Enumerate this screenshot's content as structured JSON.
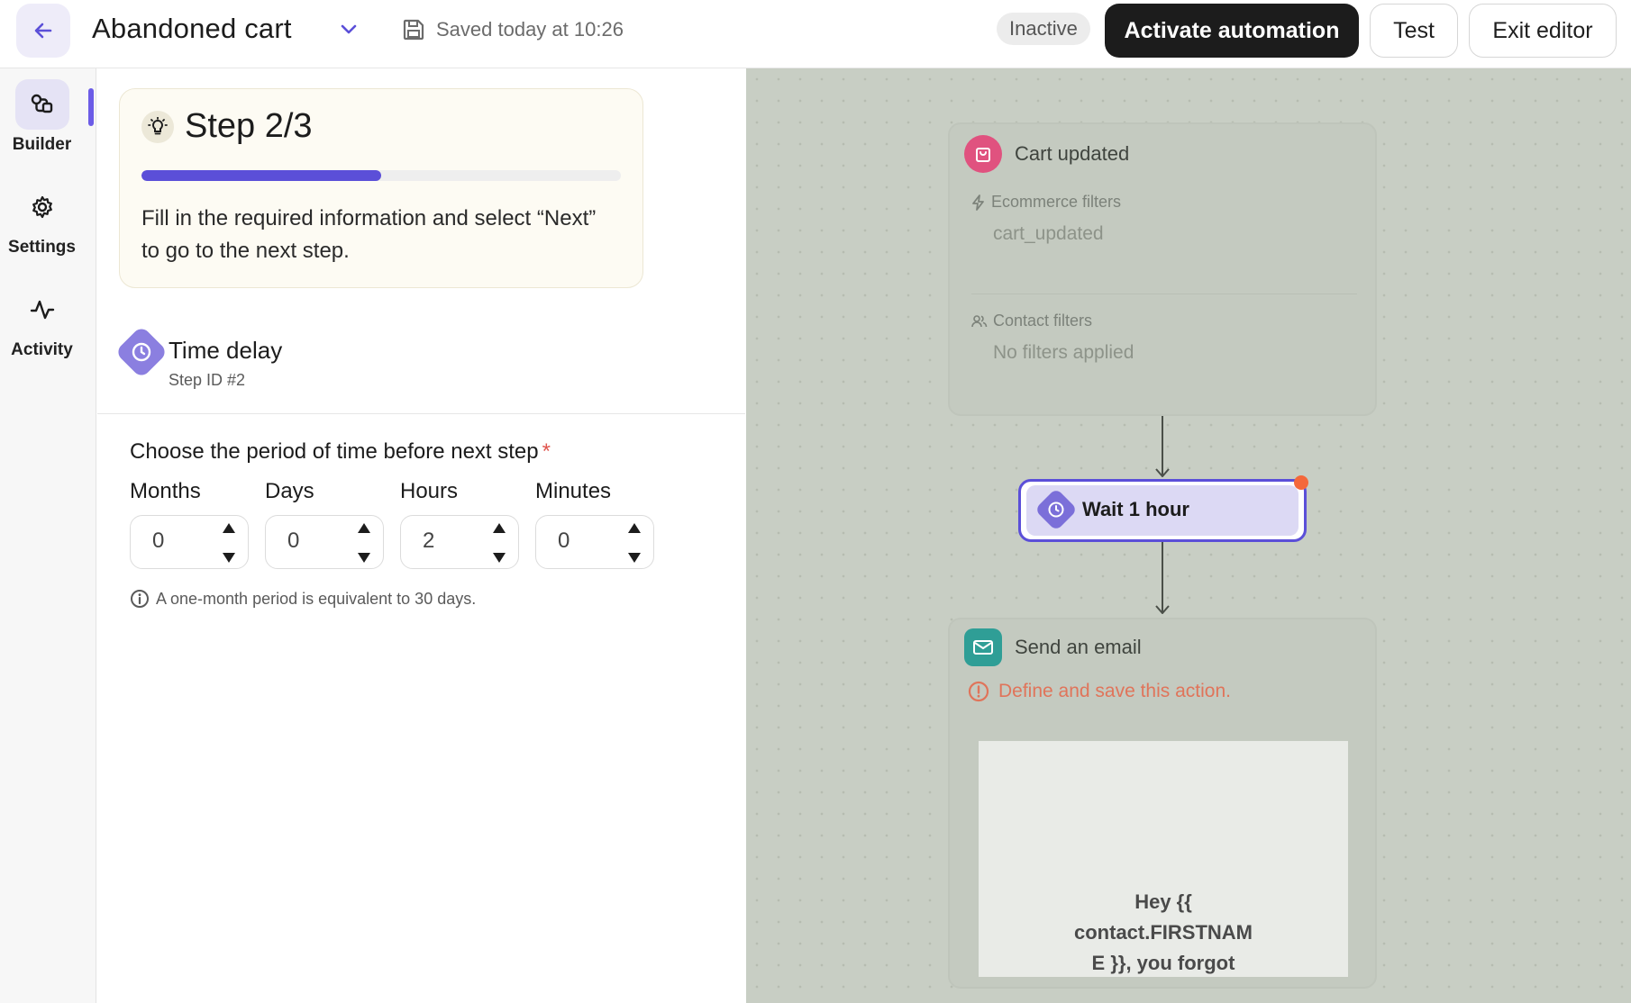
{
  "header": {
    "title": "Abandoned cart",
    "saved_text": "Saved today at 10:26",
    "status_badge": "Inactive",
    "activate_label": "Activate automation",
    "test_label": "Test",
    "exit_label": "Exit editor"
  },
  "sidebar": {
    "items": [
      {
        "label": "Builder",
        "icon": "builder-icon",
        "active": true
      },
      {
        "label": "Settings",
        "icon": "gear-icon",
        "active": false
      },
      {
        "label": "Activity",
        "icon": "activity-icon",
        "active": false
      }
    ]
  },
  "tip": {
    "title": "Step 2/3",
    "progress": 0.5,
    "text": "Fill in the required information and select “Next” to go to the next step."
  },
  "step": {
    "name": "Time delay",
    "id_label": "Step ID #2"
  },
  "period": {
    "label": "Choose the period of time before next step",
    "required_mark": "*",
    "fields": [
      {
        "unit": "Months",
        "value": "0"
      },
      {
        "unit": "Days",
        "value": "0"
      },
      {
        "unit": "Hours",
        "value": "2"
      },
      {
        "unit": "Minutes",
        "value": "0"
      }
    ],
    "info": "A one-month period is equivalent to 30 days."
  },
  "canvas": {
    "trigger": {
      "title": "Cart updated",
      "ecommerce_filters_label": "Ecommerce filters",
      "ecommerce_filters_value": "cart_updated",
      "contact_filters_label": "Contact filters",
      "contact_filters_value": "No filters applied"
    },
    "wait": {
      "label": "Wait 1 hour"
    },
    "email": {
      "title": "Send an email",
      "warning": "Define and save this action.",
      "preview_lines": [
        "Hey {{",
        "contact.FIRSTNAM",
        "E }}, you forgot"
      ]
    }
  },
  "colors": {
    "accent": "#5b4fd8",
    "trigger_icon": "#e0527f",
    "email_icon": "#2f9e96",
    "warning": "#e0745a",
    "alert_dot": "#f4683b"
  }
}
